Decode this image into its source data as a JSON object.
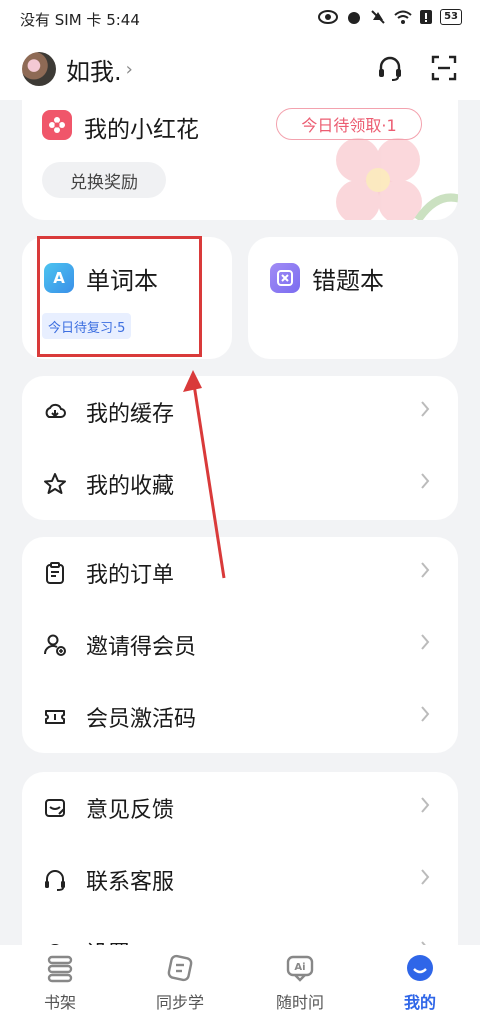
{
  "status_bar": {
    "left_text": "没有 SIM 卡 5:44",
    "battery": "53"
  },
  "header": {
    "username": "如我."
  },
  "flower_card": {
    "title": "我的小红花",
    "pending_badge": "今日待领取·1",
    "redeem_button": "兑换奖励"
  },
  "vocab_card": {
    "title": "单词本",
    "badge": "今日待复习·5",
    "icon_letter": "A"
  },
  "mistake_card": {
    "title": "错题本"
  },
  "list_group_1": [
    {
      "label": "我的缓存",
      "icon": "cloud-download-icon"
    },
    {
      "label": "我的收藏",
      "icon": "star-icon"
    }
  ],
  "list_group_2": [
    {
      "label": "我的订单",
      "icon": "clipboard-icon"
    },
    {
      "label": "邀请得会员",
      "icon": "user-add-icon"
    },
    {
      "label": "会员激活码",
      "icon": "ticket-icon"
    }
  ],
  "list_group_3": [
    {
      "label": "意见反馈",
      "icon": "feedback-icon"
    },
    {
      "label": "联系客服",
      "icon": "headset-icon"
    },
    {
      "label": "设置",
      "icon": "gear-icon"
    }
  ],
  "bottom_nav": [
    {
      "label": "书架",
      "icon": "bookshelf-icon",
      "active": false
    },
    {
      "label": "同步学",
      "icon": "sync-study-icon",
      "active": false
    },
    {
      "label": "随时问",
      "icon": "ai-chat-icon",
      "active": false
    },
    {
      "label": "我的",
      "icon": "profile-icon",
      "active": true
    }
  ],
  "colors": {
    "accent": "#2f66e8",
    "flower": "#f0566a",
    "annotation": "#d93a3a"
  }
}
